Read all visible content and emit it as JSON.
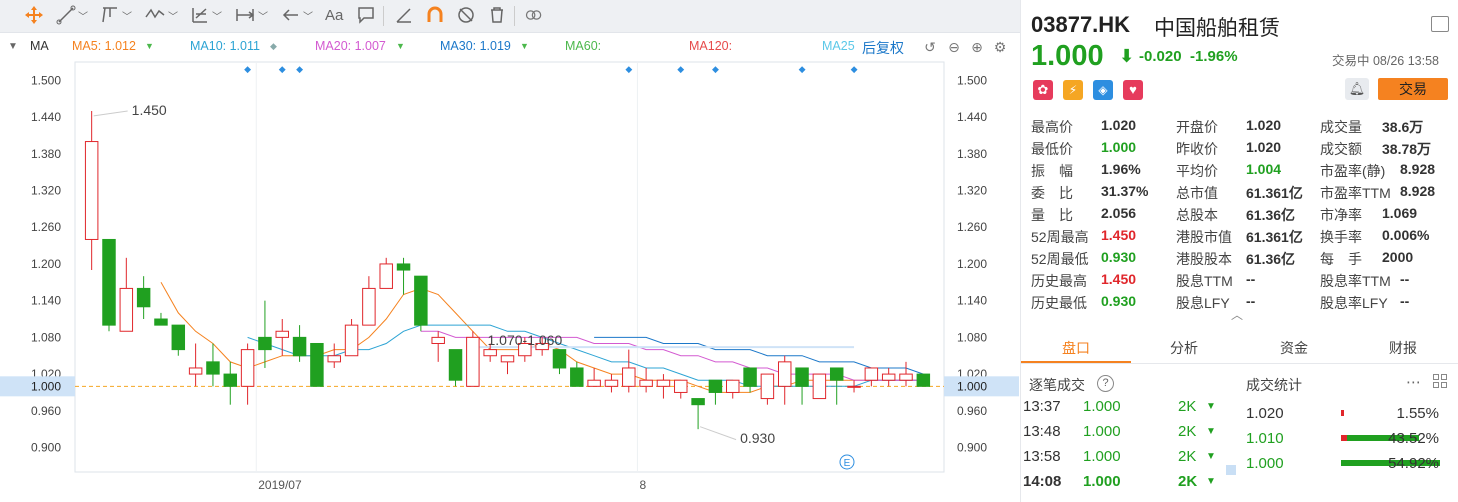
{
  "toolbar": {
    "icons": [
      "move-icon",
      "line-icon",
      "chevron-down-icon",
      "channel-icon",
      "chevron-down-icon",
      "wave-icon",
      "chevron-down-icon",
      "fib-icon",
      "chevron-down-icon",
      "measure-icon",
      "chevron-down-icon",
      "arrow-left-icon",
      "chevron-down-icon",
      "text-icon",
      "comment-icon",
      "ruler-icon",
      "magnet-icon",
      "hide-icon",
      "trash-icon",
      "link-icon"
    ],
    "text_label": "Aa"
  },
  "ma_bar": {
    "indicator": "MA",
    "ma5": "MA5: 1.012",
    "ma10": "MA10: 1.011",
    "ma20": "MA20: 1.007",
    "ma30": "MA30: 1.019",
    "ma60": "MA60:",
    "ma120": "MA120:",
    "ma250": "MA25",
    "adjust": "后复权",
    "colors": {
      "ma5": "#f5821f",
      "ma10": "#2da4d4",
      "ma20": "#d35ad1",
      "ma30": "#1c78c9",
      "ma60": "#4cb84c",
      "ma120": "#e64b4b",
      "ma250": "#5bc8e8"
    }
  },
  "chart_data": {
    "type": "candlestick",
    "ylim": [
      0.86,
      1.53
    ],
    "y_ticks": [
      "1.500",
      "1.440",
      "1.380",
      "1.320",
      "1.260",
      "1.200",
      "1.140",
      "1.080",
      "1.020",
      "1.000",
      "0.960",
      "0.900"
    ],
    "x_labels": [
      {
        "label": "2019/07",
        "index": 10
      },
      {
        "label": "8",
        "index": 32
      }
    ],
    "current_price": 1.0,
    "current_price_label": "1.000",
    "annotations": {
      "high": "1.450",
      "low": "0.930",
      "range": "1.070-1.060"
    },
    "candles": [
      {
        "o": 1.24,
        "h": 1.45,
        "l": 1.19,
        "c": 1.4
      },
      {
        "o": 1.24,
        "h": 1.24,
        "l": 1.09,
        "c": 1.1
      },
      {
        "o": 1.09,
        "h": 1.21,
        "l": 1.09,
        "c": 1.16
      },
      {
        "o": 1.16,
        "h": 1.18,
        "l": 1.11,
        "c": 1.13
      },
      {
        "o": 1.11,
        "h": 1.12,
        "l": 1.1,
        "c": 1.1
      },
      {
        "o": 1.1,
        "h": 1.1,
        "l": 1.05,
        "c": 1.06
      },
      {
        "o": 1.02,
        "h": 1.07,
        "l": 1.0,
        "c": 1.03
      },
      {
        "o": 1.04,
        "h": 1.07,
        "l": 1.0,
        "c": 1.02
      },
      {
        "o": 1.02,
        "h": 1.04,
        "l": 0.97,
        "c": 1.0
      },
      {
        "o": 1.0,
        "h": 1.07,
        "l": 0.97,
        "c": 1.06
      },
      {
        "o": 1.08,
        "h": 1.14,
        "l": 1.03,
        "c": 1.06
      },
      {
        "o": 1.08,
        "h": 1.11,
        "l": 1.05,
        "c": 1.09
      },
      {
        "o": 1.08,
        "h": 1.1,
        "l": 1.04,
        "c": 1.05
      },
      {
        "o": 1.07,
        "h": 1.07,
        "l": 1.0,
        "c": 1.0
      },
      {
        "o": 1.04,
        "h": 1.07,
        "l": 1.03,
        "c": 1.05
      },
      {
        "o": 1.05,
        "h": 1.11,
        "l": 1.05,
        "c": 1.1
      },
      {
        "o": 1.1,
        "h": 1.18,
        "l": 1.1,
        "c": 1.16
      },
      {
        "o": 1.16,
        "h": 1.21,
        "l": 1.16,
        "c": 1.2
      },
      {
        "o": 1.2,
        "h": 1.21,
        "l": 1.15,
        "c": 1.19
      },
      {
        "o": 1.18,
        "h": 1.18,
        "l": 1.09,
        "c": 1.1
      },
      {
        "o": 1.07,
        "h": 1.09,
        "l": 1.04,
        "c": 1.08
      },
      {
        "o": 1.06,
        "h": 1.06,
        "l": 1.0,
        "c": 1.01
      },
      {
        "o": 1.0,
        "h": 1.09,
        "l": 1.0,
        "c": 1.08
      },
      {
        "o": 1.05,
        "h": 1.07,
        "l": 1.04,
        "c": 1.06
      },
      {
        "o": 1.04,
        "h": 1.05,
        "l": 1.02,
        "c": 1.05
      },
      {
        "o": 1.05,
        "h": 1.08,
        "l": 1.04,
        "c": 1.07
      },
      {
        "o": 1.06,
        "h": 1.08,
        "l": 1.05,
        "c": 1.07
      },
      {
        "o": 1.06,
        "h": 1.06,
        "l": 1.02,
        "c": 1.03
      },
      {
        "o": 1.03,
        "h": 1.04,
        "l": 1.0,
        "c": 1.0
      },
      {
        "o": 1.0,
        "h": 1.03,
        "l": 1.0,
        "c": 1.01
      },
      {
        "o": 1.0,
        "h": 1.02,
        "l": 0.99,
        "c": 1.01
      },
      {
        "o": 1.0,
        "h": 1.06,
        "l": 0.99,
        "c": 1.03
      },
      {
        "o": 1.0,
        "h": 1.03,
        "l": 0.99,
        "c": 1.01
      },
      {
        "o": 1.0,
        "h": 1.02,
        "l": 0.98,
        "c": 1.01
      },
      {
        "o": 0.99,
        "h": 1.01,
        "l": 0.98,
        "c": 1.01
      },
      {
        "o": 0.98,
        "h": 0.98,
        "l": 0.93,
        "c": 0.97
      },
      {
        "o": 1.01,
        "h": 1.01,
        "l": 0.97,
        "c": 0.99
      },
      {
        "o": 0.99,
        "h": 1.01,
        "l": 0.98,
        "c": 1.01
      },
      {
        "o": 1.03,
        "h": 1.03,
        "l": 0.99,
        "c": 1.0
      },
      {
        "o": 0.98,
        "h": 1.02,
        "l": 0.97,
        "c": 1.02
      },
      {
        "o": 1.0,
        "h": 1.05,
        "l": 0.97,
        "c": 1.04
      },
      {
        "o": 1.03,
        "h": 1.03,
        "l": 0.97,
        "c": 1.0
      },
      {
        "o": 0.98,
        "h": 1.02,
        "l": 0.98,
        "c": 1.02
      },
      {
        "o": 1.03,
        "h": 1.03,
        "l": 0.97,
        "c": 1.01
      },
      {
        "o": 1.0,
        "h": 1.01,
        "l": 0.99,
        "c": 1.0
      },
      {
        "o": 1.01,
        "h": 1.03,
        "l": 1.0,
        "c": 1.03
      },
      {
        "o": 1.01,
        "h": 1.03,
        "l": 1.0,
        "c": 1.02
      },
      {
        "o": 1.01,
        "h": 1.04,
        "l": 1.0,
        "c": 1.02
      },
      {
        "o": 1.02,
        "h": 1.02,
        "l": 1.0,
        "c": 1.0
      }
    ],
    "series": [
      {
        "name": "MA5",
        "color": "#f5821f",
        "values": [
          null,
          null,
          null,
          null,
          1.17,
          1.12,
          1.09,
          1.07,
          1.04,
          1.03,
          1.04,
          1.05,
          1.05,
          1.05,
          1.06,
          1.06,
          1.08,
          1.11,
          1.15,
          1.16,
          1.15,
          1.12,
          1.09,
          1.06,
          1.06,
          1.06,
          1.07,
          1.06,
          1.04,
          1.03,
          1.02,
          1.02,
          1.01,
          1.01,
          1.01,
          1.0,
          0.99,
          0.99,
          0.99,
          1.0,
          1.0,
          1.01,
          1.01,
          1.01,
          1.01,
          1.01,
          1.01,
          1.01,
          1.01
        ]
      },
      {
        "name": "MA10",
        "color": "#2da4d4",
        "values": [
          null,
          null,
          null,
          null,
          null,
          null,
          null,
          null,
          null,
          1.08,
          1.07,
          1.06,
          1.05,
          1.05,
          1.05,
          1.06,
          1.06,
          1.07,
          1.09,
          1.1,
          1.1,
          1.1,
          1.1,
          1.1,
          1.09,
          1.09,
          1.08,
          1.07,
          1.06,
          1.05,
          1.04,
          1.04,
          1.03,
          1.03,
          1.02,
          1.01,
          1.01,
          1.01,
          1.0,
          1.0,
          1.0,
          1.0,
          1.0,
          1.0,
          1.0,
          1.01,
          1.01,
          1.01,
          1.01
        ]
      },
      {
        "name": "MA20",
        "color": "#d35ad1",
        "values": [
          null,
          null,
          null,
          null,
          null,
          null,
          null,
          null,
          null,
          null,
          null,
          null,
          null,
          null,
          null,
          null,
          null,
          null,
          null,
          1.09,
          1.09,
          1.08,
          1.08,
          1.08,
          1.08,
          1.08,
          1.08,
          1.08,
          1.08,
          1.07,
          1.07,
          1.07,
          1.06,
          1.06,
          1.05,
          1.05,
          1.04,
          1.04,
          1.03,
          1.03,
          1.02,
          1.02,
          1.02,
          1.02,
          1.01,
          1.01,
          1.01,
          1.01,
          1.01
        ]
      },
      {
        "name": "MA30",
        "color": "#1c78c9",
        "values": [
          null,
          null,
          null,
          null,
          null,
          null,
          null,
          null,
          null,
          null,
          null,
          null,
          null,
          null,
          null,
          null,
          null,
          null,
          null,
          null,
          null,
          null,
          null,
          null,
          null,
          null,
          null,
          null,
          null,
          1.08,
          1.08,
          1.08,
          1.08,
          1.07,
          1.07,
          1.07,
          1.06,
          1.06,
          1.06,
          1.05,
          1.05,
          1.05,
          1.04,
          1.04,
          1.04,
          1.03,
          1.03,
          1.03,
          1.02
        ]
      }
    ]
  },
  "quote": {
    "code": "03877.HK",
    "name": "中国船舶租赁",
    "price": "1.000",
    "change": "-0.020",
    "change_pct": "-1.96%",
    "status": "交易中 08/26 13:58",
    "trade_button": "交易",
    "fields": [
      {
        "label": "最高价",
        "value": "1.020",
        "color": "#333"
      },
      {
        "label": "开盘价",
        "value": "1.020",
        "color": "#333"
      },
      {
        "label": "成交量",
        "value": "38.6万",
        "color": "#333"
      },
      {
        "label": "最低价",
        "value": "1.000",
        "color": "#20a020"
      },
      {
        "label": "昨收价",
        "value": "1.020",
        "color": "#333"
      },
      {
        "label": "成交额",
        "value": "38.78万",
        "color": "#333"
      },
      {
        "label": "振　幅",
        "value": "1.96%",
        "color": "#333"
      },
      {
        "label": "平均价",
        "value": "1.004",
        "color": "#20a020"
      },
      {
        "label": "市盈率(静)",
        "value": "8.928",
        "color": "#333"
      },
      {
        "label": "委　比",
        "value": "31.37%",
        "color": "#333"
      },
      {
        "label": "总市值",
        "value": "61.361亿",
        "color": "#333"
      },
      {
        "label": "市盈率TTM",
        "value": "8.928",
        "color": "#333"
      },
      {
        "label": "量　比",
        "value": "2.056",
        "color": "#333"
      },
      {
        "label": "总股本",
        "value": "61.36亿",
        "color": "#333"
      },
      {
        "label": "市净率",
        "value": "1.069",
        "color": "#333"
      },
      {
        "label": "52周最高",
        "value": "1.450",
        "color": "#e0262b"
      },
      {
        "label": "港股市值",
        "value": "61.361亿",
        "color": "#333"
      },
      {
        "label": "换手率",
        "value": "0.006%",
        "color": "#333"
      },
      {
        "label": "52周最低",
        "value": "0.930",
        "color": "#20a020"
      },
      {
        "label": "港股股本",
        "value": "61.36亿",
        "color": "#333"
      },
      {
        "label": "每　手",
        "value": "2000",
        "color": "#333"
      },
      {
        "label": "历史最高",
        "value": "1.450",
        "color": "#e0262b"
      },
      {
        "label": "股息TTM",
        "value": "--",
        "color": "#333"
      },
      {
        "label": "股息率TTM",
        "value": "--",
        "color": "#333"
      },
      {
        "label": "历史最低",
        "value": "0.930",
        "color": "#20a020"
      },
      {
        "label": "股息LFY",
        "value": "--",
        "color": "#333"
      },
      {
        "label": "股息率LFY",
        "value": "--",
        "color": "#333"
      }
    ]
  },
  "tabs": [
    "盘口",
    "分析",
    "资金",
    "财报"
  ],
  "ticks_section": {
    "title": "逐笔成交",
    "help": "?",
    "rows": [
      {
        "time": "13:37",
        "price": "1.000",
        "vol": "2K"
      },
      {
        "time": "13:48",
        "price": "1.000",
        "vol": "2K"
      },
      {
        "time": "13:58",
        "price": "1.000",
        "vol": "2K"
      },
      {
        "time": "14:08",
        "price": "1.000",
        "vol": "2K"
      }
    ]
  },
  "stats_section": {
    "title": "成交统计",
    "rows": [
      {
        "price": "1.020",
        "pct": "1.55%",
        "color": "#333",
        "bar": 0.0155
      },
      {
        "price": "1.010",
        "pct": "43.52%",
        "color": "#20a020",
        "bar": 0.4352
      },
      {
        "price": "1.000",
        "pct": "54.92%",
        "color": "#20a020",
        "bar": 0.5492
      }
    ]
  }
}
